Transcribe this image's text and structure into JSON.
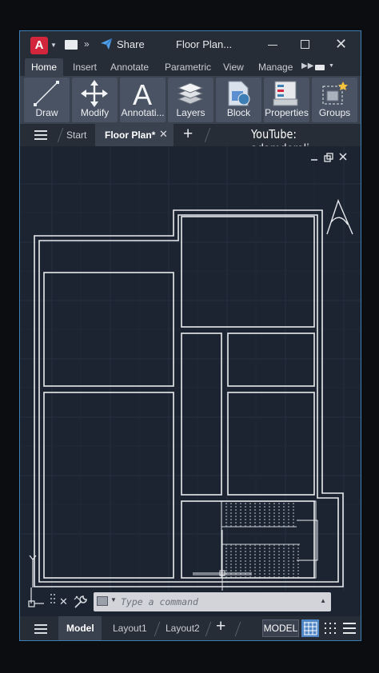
{
  "titlebar": {
    "logo": "A",
    "logo_icon": "autocad-logo-icon",
    "share_label": "Share",
    "title": "Floor Plan..."
  },
  "ribbon_tabs": [
    "Home",
    "Insert",
    "Annotate",
    "Parametric",
    "View",
    "Manage"
  ],
  "ribbon_buttons": [
    {
      "label": "Draw",
      "icon": "line-icon"
    },
    {
      "label": "Modify",
      "icon": "move-arrows-icon"
    },
    {
      "label": "Annotati...",
      "icon": "text-a-icon"
    },
    {
      "label": "Layers",
      "icon": "layers-icon"
    },
    {
      "label": "Block",
      "icon": "block-icon"
    },
    {
      "label": "Properties",
      "icon": "properties-icon"
    },
    {
      "label": "Groups",
      "icon": "groups-icon"
    }
  ],
  "doc_tabs": {
    "start": "Start",
    "active": "Floor Plan*",
    "watermark": "YouTube: adamdereli"
  },
  "command_line": {
    "placeholder": "Type a command"
  },
  "status_bar": {
    "layouts": [
      "Model",
      "Layout1",
      "Layout2"
    ],
    "mode": "MODEL"
  },
  "colors": {
    "accent": "#3d7fb5",
    "app_red": "#d3253b",
    "canvas": "#1c2431",
    "grid_active": "#4f86c6"
  }
}
